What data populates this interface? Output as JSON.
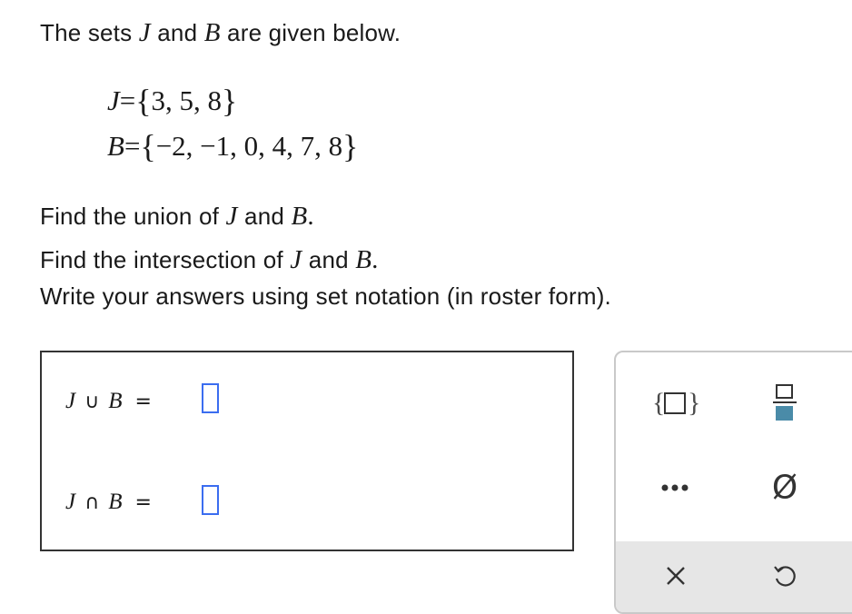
{
  "intro": {
    "prefix": "The sets",
    "var_j": "J",
    "and": "and",
    "var_b": "B",
    "suffix": "are given below."
  },
  "sets": {
    "j": {
      "name": "J",
      "eq": "=",
      "open": "{",
      "elements": "3, 5, 8",
      "close": "}"
    },
    "b": {
      "name": "B",
      "eq": "=",
      "open": "{",
      "elements": "−2, −1, 0, 4, 7, 8",
      "close": "}"
    }
  },
  "questions": {
    "union": {
      "prefix": "Find the union of",
      "var_j": "J",
      "and": "and",
      "var_b": "B",
      "end": "."
    },
    "intersection": {
      "prefix": "Find the intersection of",
      "var_j": "J",
      "and": "and",
      "var_b": "B",
      "end": "."
    },
    "instruction": "Write your answers using set notation (in roster form)."
  },
  "answers": {
    "union": {
      "left": "J",
      "op": "∪",
      "right": "B",
      "eq": "=",
      "value": ""
    },
    "intersection": {
      "left": "J",
      "op": "∩",
      "right": "B",
      "eq": "=",
      "value": ""
    }
  },
  "toolbar": {
    "icons": [
      "set-braces-icon",
      "fraction-icon",
      "ellipsis-icon",
      "empty-set-icon",
      "clear-icon",
      "undo-icon"
    ],
    "empty_set_symbol": "Ø",
    "accent_color": "#3b6df0",
    "icon_color": "#4a8ba8"
  }
}
